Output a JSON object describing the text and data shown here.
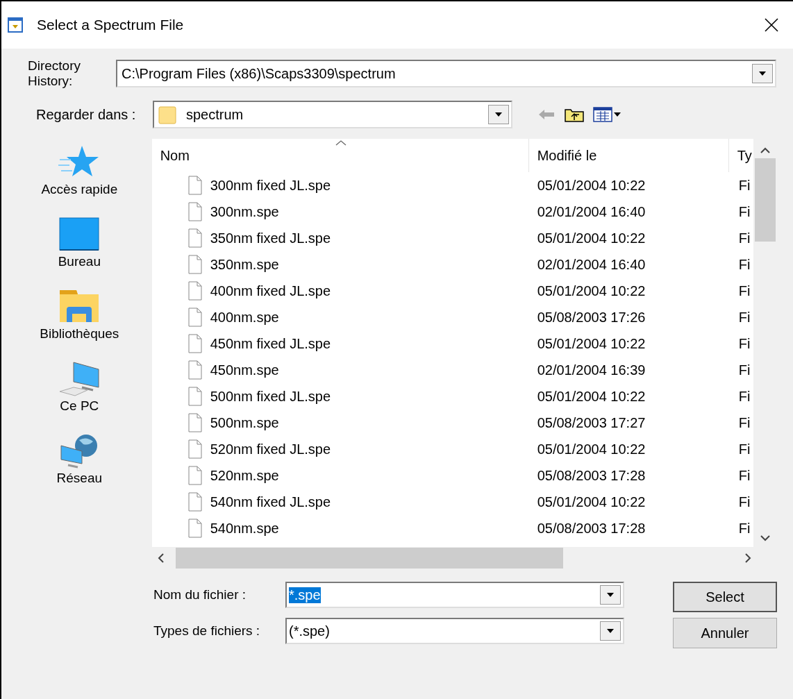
{
  "window": {
    "title": "Select a Spectrum File"
  },
  "directory_history": {
    "label": "Directory\nHistory:",
    "value": "C:\\Program Files (x86)\\Scaps3309\\spectrum"
  },
  "look_in": {
    "label": "Regarder dans :",
    "value": "spectrum"
  },
  "places": [
    {
      "label": "Accès rapide",
      "kind": "star"
    },
    {
      "label": "Bureau",
      "kind": "desktop"
    },
    {
      "label": "Bibliothèques",
      "kind": "library"
    },
    {
      "label": "Ce PC",
      "kind": "computer"
    },
    {
      "label": "Réseau",
      "kind": "network"
    }
  ],
  "table": {
    "columns": [
      "Nom",
      "Modifié le",
      "Ty"
    ],
    "rows": [
      {
        "name": "300nm fixed JL.spe",
        "modified": "05/01/2004 10:22",
        "type": "Fi"
      },
      {
        "name": "300nm.spe",
        "modified": "02/01/2004 16:40",
        "type": "Fi"
      },
      {
        "name": "350nm fixed JL.spe",
        "modified": "05/01/2004 10:22",
        "type": "Fi"
      },
      {
        "name": "350nm.spe",
        "modified": "02/01/2004 16:40",
        "type": "Fi"
      },
      {
        "name": "400nm fixed JL.spe",
        "modified": "05/01/2004 10:22",
        "type": "Fi"
      },
      {
        "name": "400nm.spe",
        "modified": "05/08/2003 17:26",
        "type": "Fi"
      },
      {
        "name": "450nm fixed JL.spe",
        "modified": "05/01/2004 10:22",
        "type": "Fi"
      },
      {
        "name": "450nm.spe",
        "modified": "02/01/2004 16:39",
        "type": "Fi"
      },
      {
        "name": "500nm fixed JL.spe",
        "modified": "05/01/2004 10:22",
        "type": "Fi"
      },
      {
        "name": "500nm.spe",
        "modified": "05/08/2003 17:27",
        "type": "Fi"
      },
      {
        "name": "520nm fixed JL.spe",
        "modified": "05/01/2004 10:22",
        "type": "Fi"
      },
      {
        "name": "520nm.spe",
        "modified": "05/08/2003 17:28",
        "type": "Fi"
      },
      {
        "name": "540nm fixed JL.spe",
        "modified": "05/01/2004 10:22",
        "type": "Fi"
      },
      {
        "name": "540nm.spe",
        "modified": "05/08/2003 17:28",
        "type": "Fi"
      }
    ]
  },
  "file_name": {
    "label": "Nom du fichier :",
    "value": "*.spe",
    "selected": true
  },
  "file_type": {
    "label": "Types de fichiers :",
    "value": "(*.spe)"
  },
  "buttons": [
    "Select",
    "Annuler"
  ]
}
